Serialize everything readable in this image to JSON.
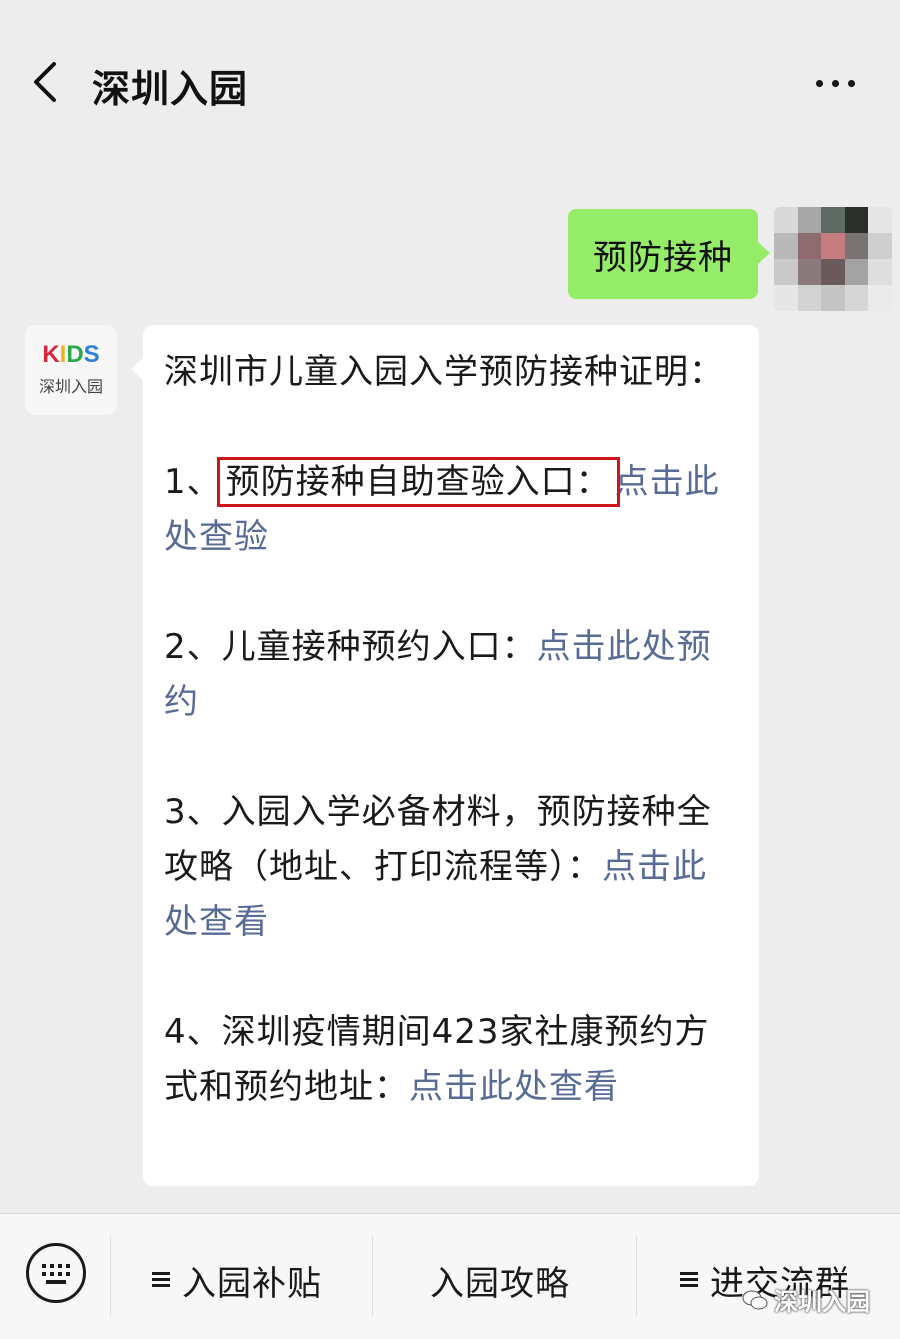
{
  "header": {
    "title": "深圳入园",
    "back_icon": "chevron-left-icon",
    "more_icon": "more-dots-icon"
  },
  "outgoing": {
    "text": "预防接种"
  },
  "bot": {
    "avatar_logo": "KIDS",
    "avatar_caption": "深圳入园",
    "paragraphs": [
      {
        "text": "深圳市儿童入园入学预防接种证明："
      },
      {
        "prefix": "1、",
        "highlight": "预防接种自助查验入口：",
        "link": "点击此处查验"
      },
      {
        "prefix": "2、儿童接种预约入口：",
        "link": "点击此处预约"
      },
      {
        "prefix": "3、入园入学必备材料，预防接种全攻略（地址、打印流程等）：",
        "link": "点击此处查看"
      },
      {
        "prefix": "4、深圳疫情期间423家社康预约方式和预约地址：",
        "link": "点击此处查看"
      }
    ]
  },
  "bottom_menu": {
    "keyboard_icon": "keyboard-icon",
    "items": [
      {
        "label": "入园补贴",
        "icon": "menu-list-icon"
      },
      {
        "label": "入园攻略"
      },
      {
        "label": "进交流群",
        "icon": "menu-list-icon"
      }
    ]
  },
  "watermark": {
    "text": "深圳入园"
  },
  "colors": {
    "bg": "#ededed",
    "outgoing_bubble": "#95ec69",
    "link": "#576b95",
    "highlight_border": "#d0161b"
  }
}
